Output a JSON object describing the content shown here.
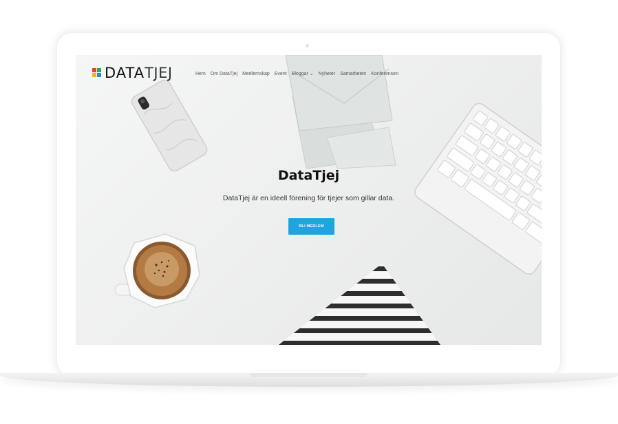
{
  "site": {
    "logo": {
      "bold": "DATA",
      "light": "TJEJ"
    },
    "nav": [
      "Hem",
      "Om DataTjej",
      "Medlemskap",
      "Event",
      "Bloggar ⌄",
      "Nyheter",
      "Samarbeten",
      "Konferensen"
    ]
  },
  "hero": {
    "title": "DataTjej",
    "subtitle": "DataTjej är en ideell förening för tjejer som gillar data.",
    "cta": "BLI MEDLEM"
  },
  "colors": {
    "accent": "#1fa4e0",
    "logo_squares": [
      "#e8412f",
      "#2fa84f",
      "#f5b51a",
      "#1f8fd6"
    ]
  },
  "icons": [
    "phone-image",
    "envelope-image",
    "keyboard-image",
    "coffee-cup-image",
    "striped-triangle-image"
  ]
}
